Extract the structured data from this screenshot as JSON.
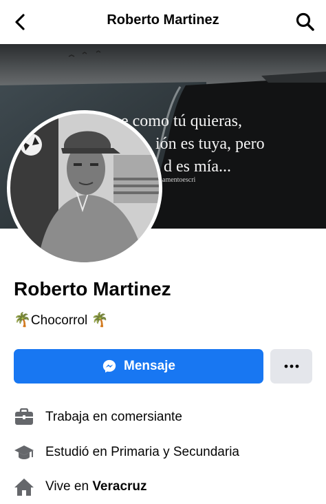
{
  "header": {
    "title": "Roberto Martinez",
    "back_icon": "chevron-left-icon",
    "search_icon": "search-icon"
  },
  "cover": {
    "quote_line1": "e como tú quieras,",
    "quote_line2": "ión es tuya, pero",
    "quote_line3": "d es mía...",
    "credit": "amentoescri"
  },
  "profile": {
    "name": "Roberto Martinez",
    "bio_emoji": "🌴",
    "bio_text": "Chocorrol"
  },
  "actions": {
    "message_label": "Mensaje",
    "message_icon": "messenger-icon",
    "more_label": "···",
    "primary_color": "#1877f2"
  },
  "details": {
    "work": {
      "icon": "briefcase-icon",
      "text": "Trabaja en comersiante"
    },
    "education": {
      "icon": "graduation-cap-icon",
      "text": "Estudió en Primaria y Secundaria"
    },
    "lives": {
      "icon": "home-icon",
      "prefix": "Vive en ",
      "place": "Veracruz"
    }
  }
}
